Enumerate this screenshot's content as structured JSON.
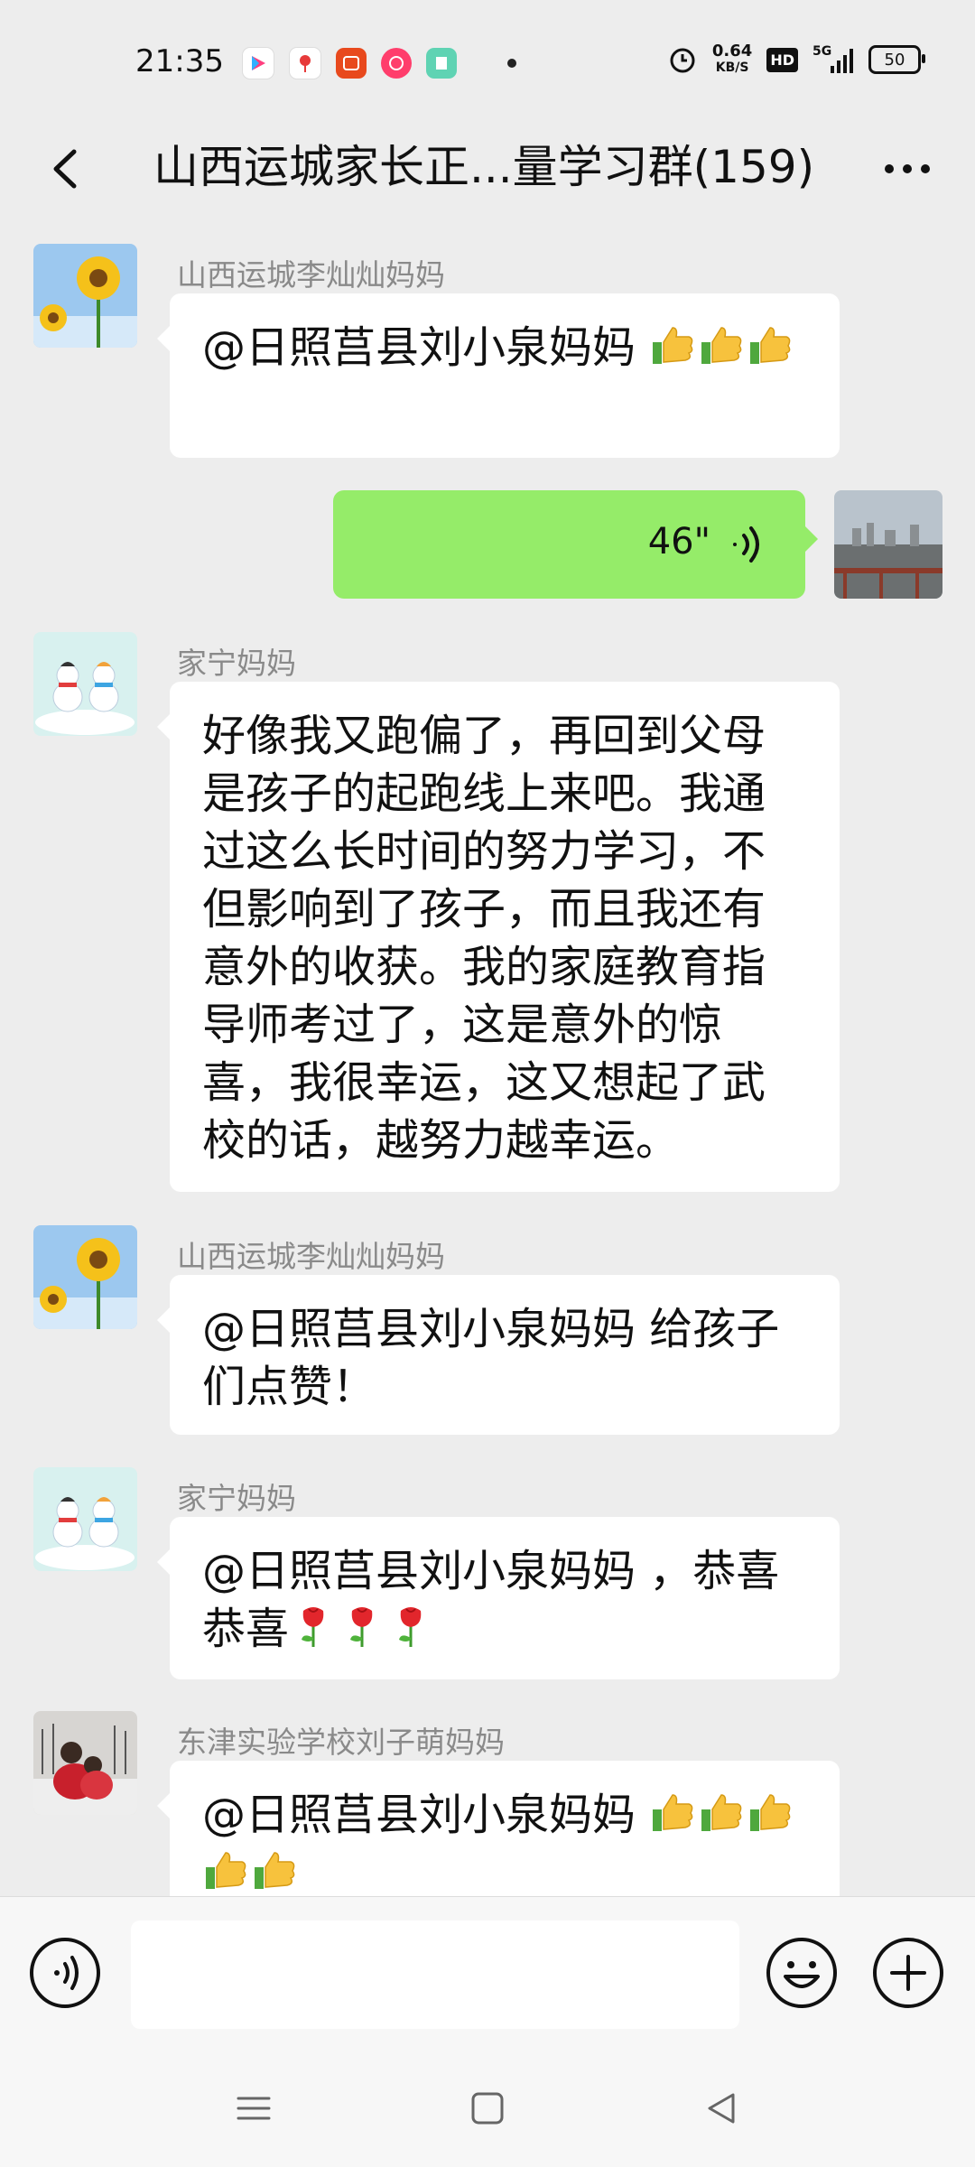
{
  "status_bar": {
    "time": "21:35",
    "net_speed_value": "0.64",
    "net_speed_unit": "KB/S",
    "hd": "HD",
    "network": "5G",
    "battery": "50"
  },
  "header": {
    "title": "山西运城家长正...量学习群(159)"
  },
  "messages": [
    {
      "sender": "山西运城李灿灿妈妈",
      "text": "@日照莒县刘小泉妈妈 ",
      "emoji_count": 3
    },
    {
      "voice_duration": "46\""
    },
    {
      "sender": "家宁妈妈",
      "text": "好像我又跑偏了，再回到父母是孩子的起跑线上来吧。我通过这么长时间的努力学习，不但影响到了孩子，而且我还有意外的收获。我的家庭教育指导师考过了，这是意外的惊喜，我很幸运，这又想起了武校的话，越努力越幸运。"
    },
    {
      "sender": "山西运城李灿灿妈妈",
      "text": "@日照莒县刘小泉妈妈  给孩子们点赞！"
    },
    {
      "sender": "家宁妈妈",
      "text": "@日照莒县刘小泉妈妈 ，恭喜恭喜"
    },
    {
      "sender": "东津实验学校刘子萌妈妈",
      "text": "@日照莒县刘小泉妈妈 "
    }
  ],
  "icons": {
    "back": "chevron-left-icon",
    "more": "more-dots-icon",
    "voice": "voice-wave-icon",
    "emoji": "smiley-icon",
    "plus": "plus-circle-icon",
    "thumbs": "thumbs-up-emoji",
    "rose": "rose-emoji"
  },
  "colors": {
    "self_bubble": "#95ec69",
    "other_bubble": "#ffffff",
    "background": "#ededed"
  }
}
